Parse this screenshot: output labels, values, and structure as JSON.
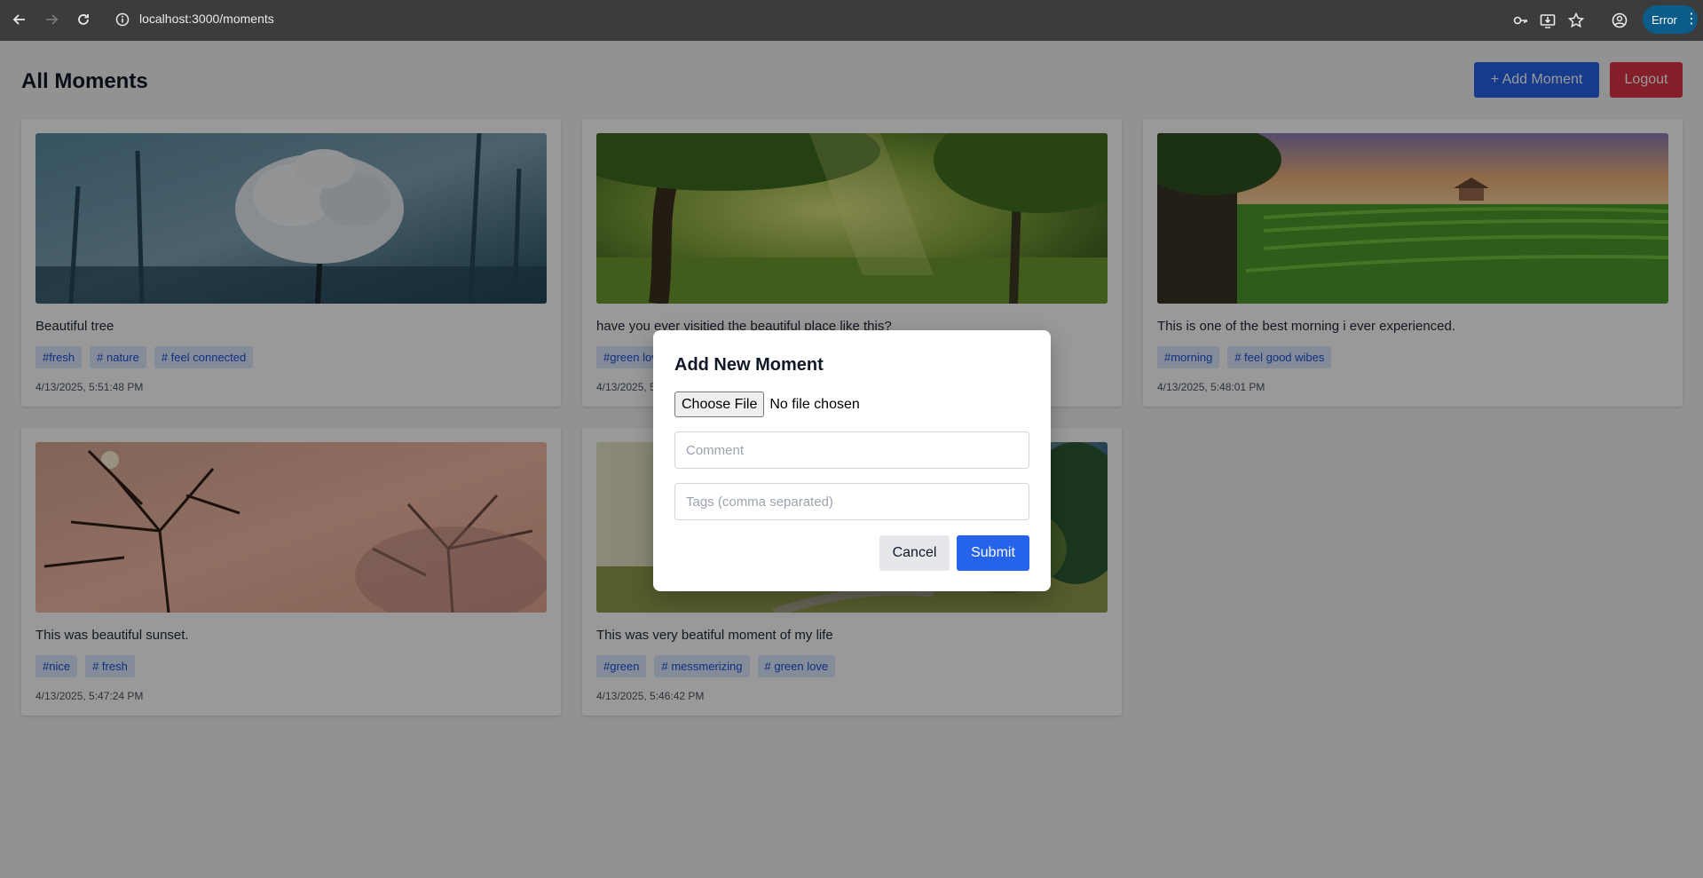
{
  "browser": {
    "url": "localhost:3000/moments",
    "profile_status": "Error",
    "icons": [
      "back-icon",
      "forward-icon",
      "reload-icon",
      "site-info-icon",
      "password-key-icon",
      "install-app-icon",
      "bookmark-star-icon",
      "profile-icon",
      "menu-dots-icon"
    ]
  },
  "header": {
    "title": "All Moments",
    "add_label": "+ Add Moment",
    "logout_label": "Logout"
  },
  "moments": [
    {
      "comment": "Beautiful tree",
      "tags": [
        "#fresh",
        "# nature",
        "# feel connected"
      ],
      "date": "4/13/2025, 5:51:48 PM"
    },
    {
      "comment": "have you ever visitied the beautiful place like this?",
      "tags": [
        "#green love"
      ],
      "date": "4/13/2025, 5:50:01 PM"
    },
    {
      "comment": "This is one of the best morning i ever experienced.",
      "tags": [
        "#morning",
        "# feel good wibes"
      ],
      "date": "4/13/2025, 5:48:01 PM"
    },
    {
      "comment": "This was beautiful sunset.",
      "tags": [
        "#nice",
        "# fresh"
      ],
      "date": "4/13/2025, 5:47:24 PM"
    },
    {
      "comment": "This was very beatiful moment of my life",
      "tags": [
        "#green",
        "# messmerizing",
        "# green love"
      ],
      "date": "4/13/2025, 5:46:42 PM"
    }
  ],
  "modal": {
    "title": "Add New Moment",
    "file_button": "Choose File",
    "file_status": "No file chosen",
    "comment_placeholder": "Comment",
    "comment_value": "",
    "tags_placeholder": "Tags (comma separated)",
    "tags_value": "",
    "cancel_label": "Cancel",
    "submit_label": "Submit"
  },
  "colors": {
    "primary": "#2563eb",
    "danger": "#dc3545",
    "tag_bg": "#dbeafe",
    "tag_text": "#1d4ed8",
    "overlay": "rgba(0,0,0,0.4)"
  }
}
